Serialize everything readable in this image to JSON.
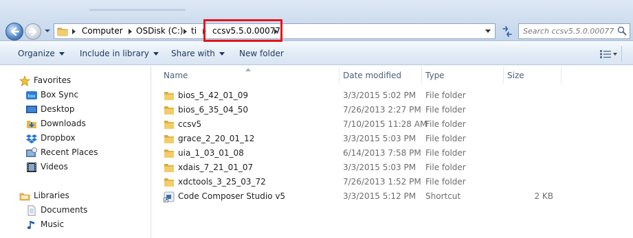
{
  "address": {
    "crumbs": [
      "Computer",
      "OSDisk (C:)",
      "ti",
      "ccsv5.5.0.00077"
    ]
  },
  "search": {
    "placeholder": "Search ccsv5.5.0.00077"
  },
  "toolbar": {
    "organize": "Organize",
    "include_in_library": "Include in library",
    "share_with": "Share with",
    "new_folder": "New folder"
  },
  "nav": {
    "favorites": {
      "header": "Favorites",
      "items": [
        {
          "label": "Box Sync",
          "icon": "box-sync-icon"
        },
        {
          "label": "Desktop",
          "icon": "desktop-icon"
        },
        {
          "label": "Downloads",
          "icon": "downloads-icon"
        },
        {
          "label": "Dropbox",
          "icon": "dropbox-icon"
        },
        {
          "label": "Recent Places",
          "icon": "recent-places-icon"
        },
        {
          "label": "Videos",
          "icon": "videos-icon"
        }
      ]
    },
    "libraries": {
      "header": "Libraries",
      "items": [
        {
          "label": "Documents",
          "icon": "documents-icon"
        },
        {
          "label": "Music",
          "icon": "music-icon"
        }
      ]
    }
  },
  "columns": {
    "name": "Name",
    "date_modified": "Date modified",
    "type": "Type",
    "size": "Size"
  },
  "files": [
    {
      "name": "bios_5_42_01_09",
      "date": "3/3/2015 5:02 PM",
      "type": "File folder",
      "size": "",
      "icon": "folder-icon"
    },
    {
      "name": "bios_6_35_04_50",
      "date": "7/26/2013 2:27 PM",
      "type": "File folder",
      "size": "",
      "icon": "folder-icon"
    },
    {
      "name": "ccsv5",
      "date": "7/10/2015 11:28 AM",
      "type": "File folder",
      "size": "",
      "icon": "folder-icon"
    },
    {
      "name": "grace_2_20_01_12",
      "date": "3/3/2015 5:03 PM",
      "type": "File folder",
      "size": "",
      "icon": "folder-icon"
    },
    {
      "name": "uia_1_03_01_08",
      "date": "6/14/2013 7:58 PM",
      "type": "File folder",
      "size": "",
      "icon": "folder-icon"
    },
    {
      "name": "xdais_7_21_01_07",
      "date": "3/3/2015 5:03 PM",
      "type": "File folder",
      "size": "",
      "icon": "folder-icon"
    },
    {
      "name": "xdctools_3_25_03_72",
      "date": "7/26/2013 1:52 PM",
      "type": "File folder",
      "size": "",
      "icon": "folder-icon"
    },
    {
      "name": "Code Composer Studio v5",
      "date": "3/3/2015 5:12 PM",
      "type": "Shortcut",
      "size": "2 KB",
      "icon": "shortcut-icon"
    }
  ],
  "colors": {
    "highlight_box": "#e4141c",
    "toolbar_text": "#1e395b",
    "folder": "#e8b84a"
  }
}
